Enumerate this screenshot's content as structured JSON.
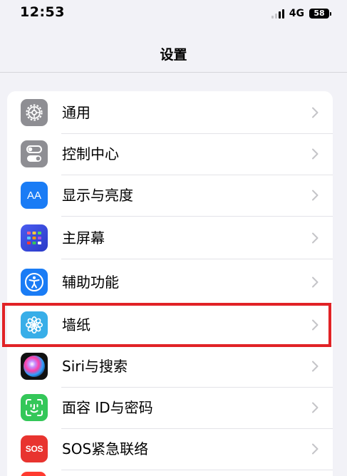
{
  "status_bar": {
    "time": "12:53",
    "network": "4G",
    "battery": "58"
  },
  "nav": {
    "title": "设置"
  },
  "settings": {
    "items": [
      {
        "label": "通用",
        "icon": "gear-icon",
        "color": "#8e8e93"
      },
      {
        "label": "控制中心",
        "icon": "toggles-icon",
        "color": "#8e8e93"
      },
      {
        "label": "显示与亮度",
        "icon": "text-size-icon",
        "color": "#1a7cf5",
        "icon_text": "AA"
      },
      {
        "label": "主屏幕",
        "icon": "app-grid-icon",
        "color": "#3a52e0"
      },
      {
        "label": "辅助功能",
        "icon": "accessibility-icon",
        "color": "#1a7cf5"
      },
      {
        "label": "墙纸",
        "icon": "flower-icon",
        "color": "#38aee8"
      },
      {
        "label": "Siri与搜索",
        "icon": "siri-icon",
        "color": "#1c1c2e"
      },
      {
        "label": "面容 ID与密码",
        "icon": "face-id-icon",
        "color": "#34c759"
      },
      {
        "label": "SOS紧急联络",
        "icon": "sos-icon",
        "color": "#e8342f",
        "icon_text": "SOS"
      }
    ],
    "highlighted_item": "墙纸"
  },
  "colors": {
    "background": "#f2f2f7",
    "highlight": "#e12226",
    "chevron": "#c4c4c8"
  }
}
